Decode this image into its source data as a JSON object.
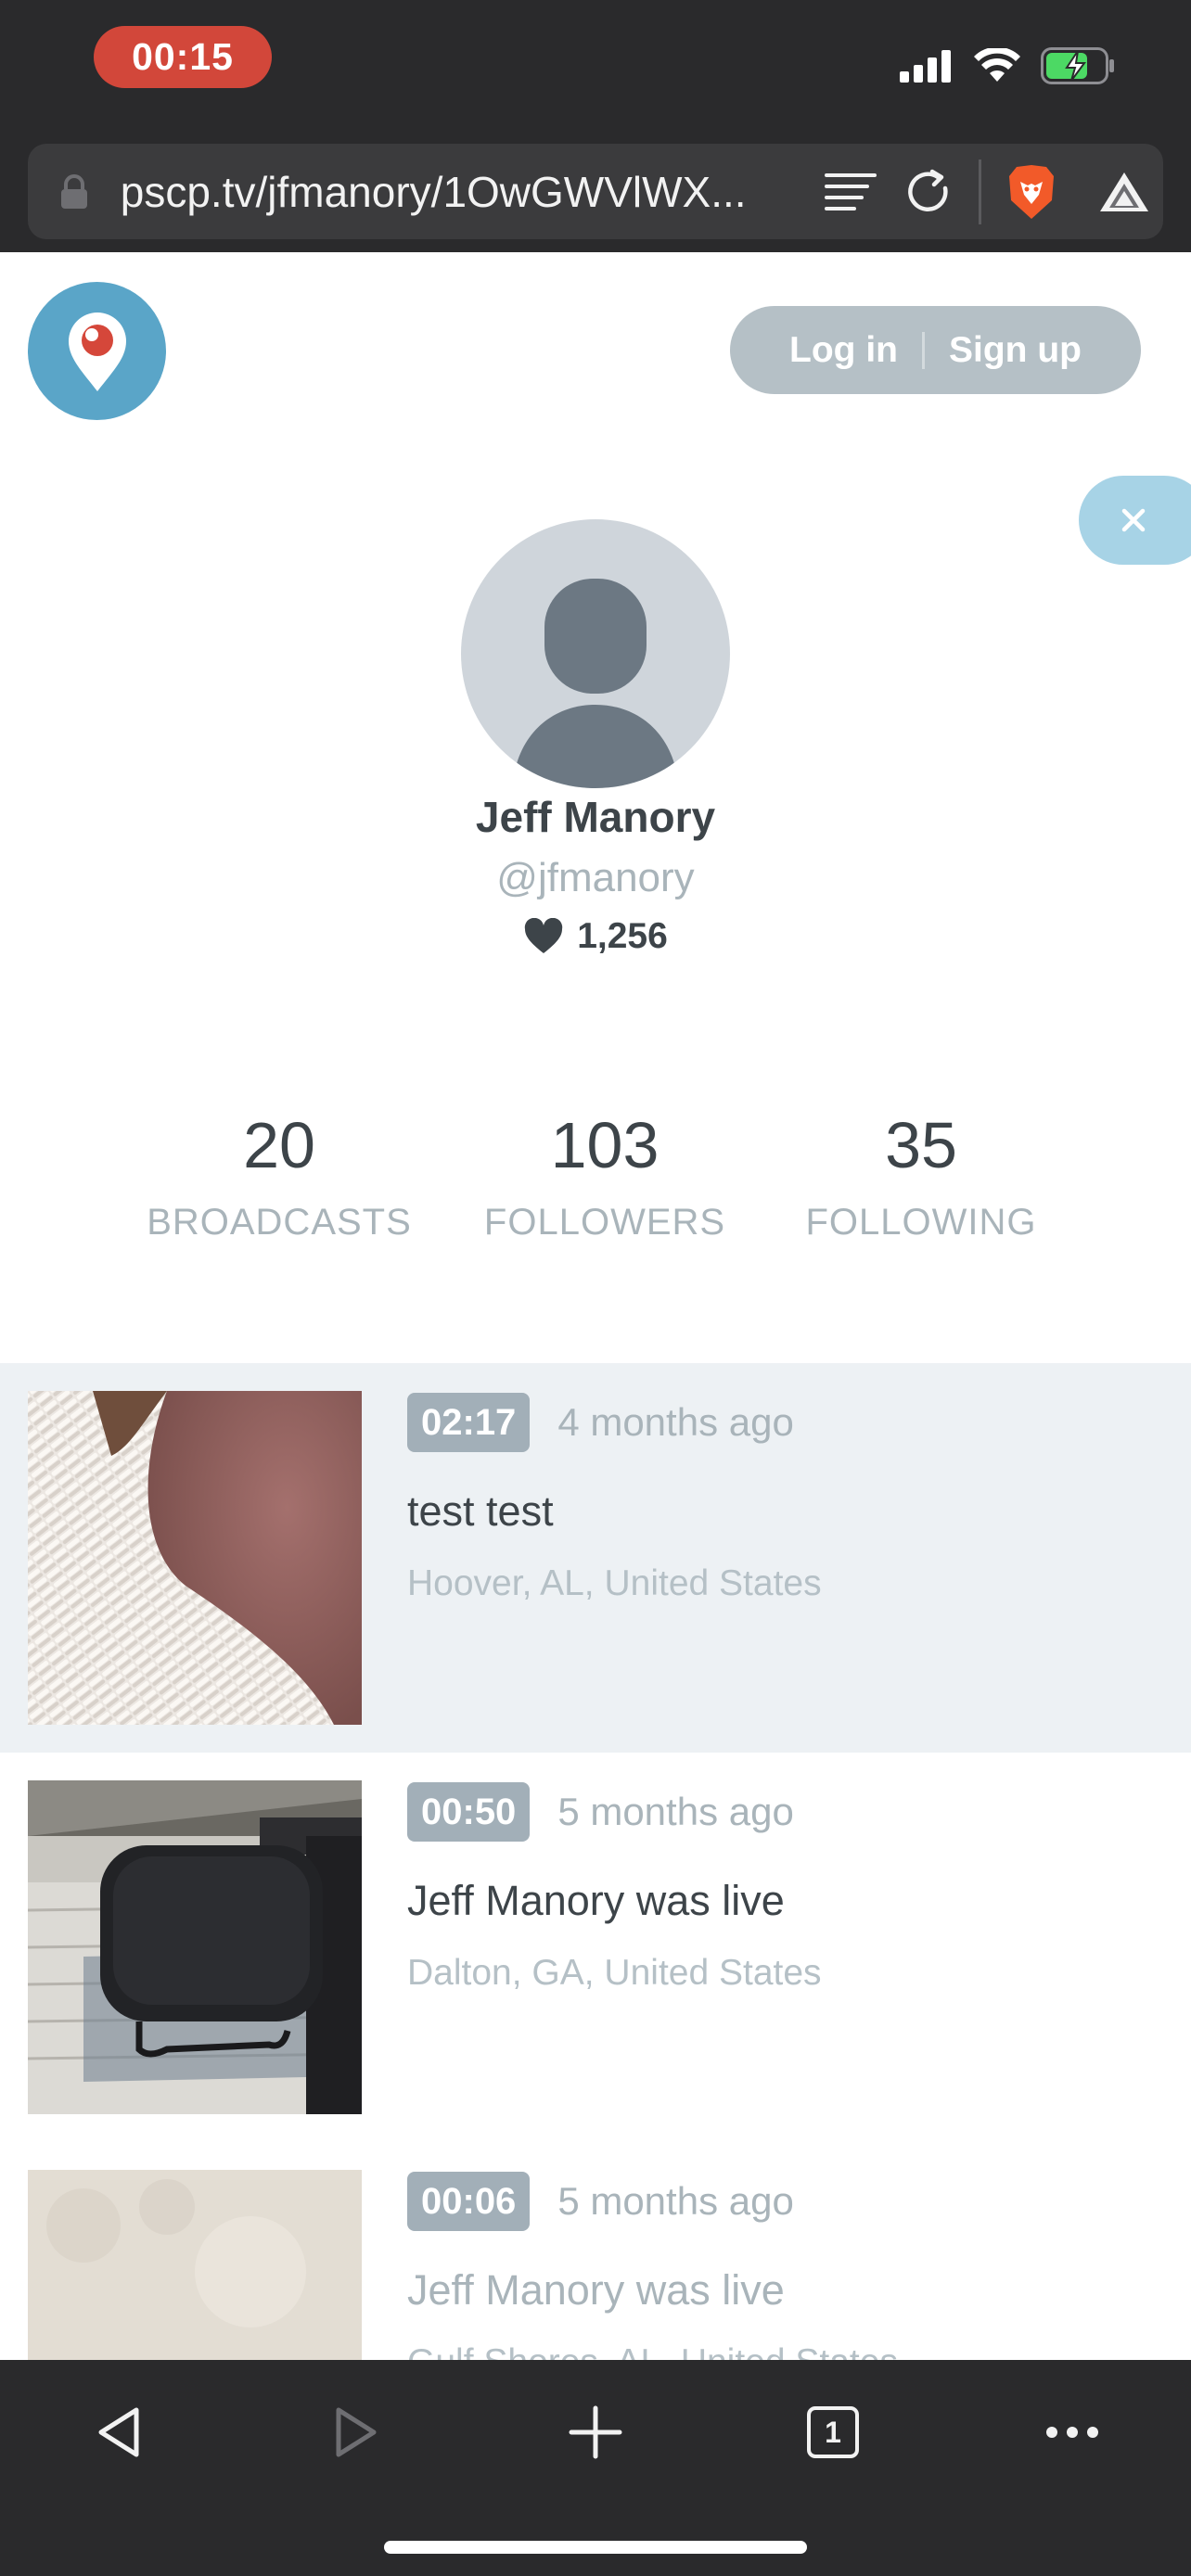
{
  "status_bar": {
    "recording_time": "00:15"
  },
  "browser": {
    "url": "pscp.tv/jfmanory/1OwGWVlWX...",
    "tab_count": "1"
  },
  "header": {
    "login_label": "Log in",
    "signup_label": "Sign up"
  },
  "profile": {
    "name": "Jeff Manory",
    "handle": "@jfmanory",
    "hearts": "1,256"
  },
  "stats": [
    {
      "value": "20",
      "label": "BROADCASTS"
    },
    {
      "value": "103",
      "label": "FOLLOWERS"
    },
    {
      "value": "35",
      "label": "FOLLOWING"
    }
  ],
  "broadcasts": [
    {
      "duration": "02:17",
      "age": "4 months ago",
      "title": "test test",
      "location": "Hoover, AL, United States"
    },
    {
      "duration": "00:50",
      "age": "5 months ago",
      "title": "Jeff Manory was live",
      "location": "Dalton, GA, United States"
    },
    {
      "duration": "00:06",
      "age": "5 months ago",
      "title": "Jeff Manory was live",
      "location": "Gulf Shores, AL, United States"
    }
  ],
  "colors": {
    "brand_blue": "#5aa5c8",
    "record_red": "#d2473a",
    "text_dark": "#3d4449",
    "text_muted": "#a9b4ba"
  }
}
